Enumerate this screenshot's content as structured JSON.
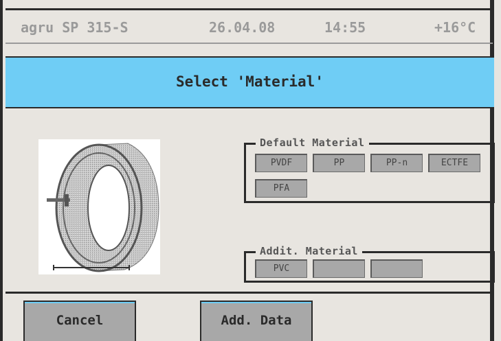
{
  "status": {
    "device": "agru SP 315-S",
    "date": "26.04.08",
    "time": "14:55",
    "temperature": "+16°C"
  },
  "title": "Select 'Material'",
  "image": {
    "icon": "pipe-fitting-icon"
  },
  "default_group": {
    "title": "Default Material",
    "buttons": [
      "PVDF",
      "PP",
      "PP-n",
      "ECTFE",
      "PFA"
    ]
  },
  "addit_group": {
    "title": "Addit. Material",
    "buttons": [
      "PVC",
      "",
      ""
    ]
  },
  "footer": {
    "cancel_label": "Cancel",
    "add_data_label": "Add. Data"
  },
  "colors": {
    "title_bar": "#6fcdf5",
    "button": "#a8a8a8",
    "background": "#e8e5e0"
  }
}
